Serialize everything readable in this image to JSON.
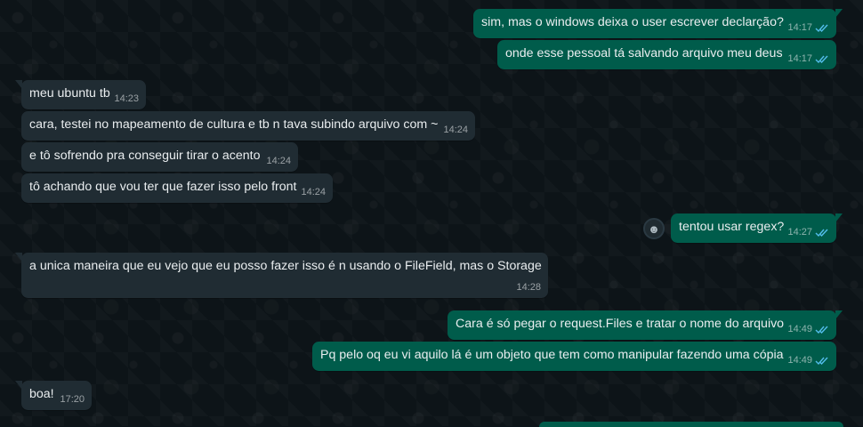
{
  "messages": [
    {
      "id": "m1",
      "dir": "out",
      "text": "sim, mas o windows deixa o user escrever declarção?",
      "time": "14:17",
      "read": true
    },
    {
      "id": "m2",
      "dir": "out",
      "text": "onde esse pessoal tá salvando arquivo meu deus",
      "time": "14:17",
      "read": true
    },
    {
      "id": "m3",
      "dir": "in",
      "text": "meu ubuntu tb",
      "time": "14:23"
    },
    {
      "id": "m4",
      "dir": "in",
      "text": "cara, testei no mapeamento de cultura e tb n tava subindo arquivo com ~",
      "time": "14:24"
    },
    {
      "id": "m5",
      "dir": "in",
      "text": "e tô sofrendo pra conseguir tirar o acento",
      "time": "14:24"
    },
    {
      "id": "m6",
      "dir": "in",
      "text": "tô achando que vou ter que fazer isso pelo front",
      "time": "14:24"
    },
    {
      "id": "m7",
      "dir": "out",
      "text": "tentou usar regex?",
      "time": "14:27",
      "read": true
    },
    {
      "id": "m8",
      "dir": "in",
      "text": "a unica maneira que eu vejo que eu posso fazer isso é n usando o FileField, mas o Storage",
      "time": "14:28"
    },
    {
      "id": "m9",
      "dir": "out",
      "text": "Cara é só pegar o request.Files e tratar o nome do arquivo",
      "time": "14:49",
      "read": true
    },
    {
      "id": "m10",
      "dir": "out",
      "text": "Pq pelo oq eu vi aquilo lá é um objeto que tem como manipular fazendo uma cópia",
      "time": "14:49",
      "read": true
    },
    {
      "id": "m11",
      "dir": "in",
      "text": "boa!",
      "time": "17:20"
    }
  ],
  "colors": {
    "incoming_bubble": "#202c33",
    "outgoing_bubble": "#005c4b",
    "read_tick": "#53bdeb",
    "background": "#0b141a"
  },
  "icons": {
    "read_receipt": "double-check-icon",
    "reaction": "emoji-smile-icon"
  }
}
